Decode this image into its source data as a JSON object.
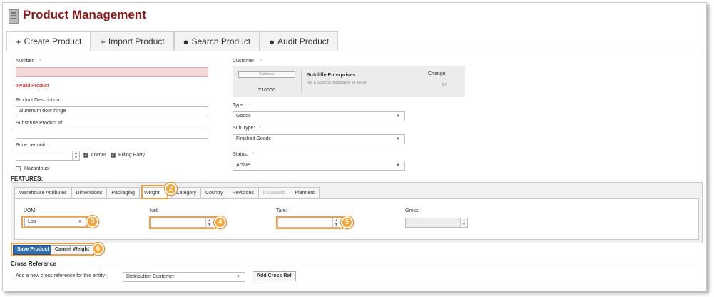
{
  "app": {
    "title": "Product Management"
  },
  "top_tabs": [
    {
      "icon": "+",
      "label": "Create Product"
    },
    {
      "icon": "+",
      "label": "Import Product"
    },
    {
      "icon": "●",
      "label": "Search Product"
    },
    {
      "icon": "●",
      "label": "Audit Product"
    }
  ],
  "form": {
    "number_label": "Number:",
    "required_mark": "*",
    "number_value": "",
    "number_error": "Invalid Product",
    "description_label": "Product Description:",
    "description_value": "aluminum door hinge",
    "substitute_label": "Substitute Product Id:",
    "substitute_value": "",
    "price_label": "Price per unit:",
    "price_value": "",
    "owner_label": "Owner",
    "owner_checked": true,
    "billing_label": "Billing Party",
    "billing_checked": true,
    "hazardous_label": "Hazardous",
    "hazardous_checked": false
  },
  "customer": {
    "label": "Customer:",
    "button_label": "Customer",
    "code": "T10000",
    "name": "Sutcliffe Enterprises",
    "address": "500 E South St, Kalamazoo MI 49048",
    "change_link": "Change",
    "tz": "ET"
  },
  "type_field": {
    "label": "Type:",
    "value": "Goods"
  },
  "subtype_field": {
    "label": "Sub Type:",
    "value": "Finished Goods"
  },
  "status_field": {
    "label": "Status:",
    "value": "Active"
  },
  "features": {
    "title": "FEATURES:",
    "tabs": [
      {
        "label": "Warehouse Attributes"
      },
      {
        "label": "Dimensions"
      },
      {
        "label": "Packaging"
      },
      {
        "label": "Weight"
      },
      {
        "label": "Category"
      },
      {
        "label": "Country"
      },
      {
        "label": "Revisions"
      },
      {
        "label": "Kit Details"
      },
      {
        "label": "Planners"
      }
    ],
    "weight": {
      "uom_label": "UOM:",
      "uom_value": "Lbs",
      "net_label": "Net:",
      "net_value": "",
      "tare_label": "Tare:",
      "tare_value": "",
      "gross_label": "Gross:",
      "gross_value": ""
    }
  },
  "actions": {
    "save_label": "Save Product",
    "cancel_label": "Cancel Weight"
  },
  "cross_ref": {
    "title": "Cross Reference",
    "add_label": "Add a new cross reference for this entity :",
    "select_value": "Distribution Customer",
    "button_label": "Add Cross Ref"
  },
  "callouts": [
    "2",
    "3",
    "4",
    "5",
    "6"
  ],
  "colors": {
    "title": "#8b1a1a",
    "primary": "#2f6fb1",
    "callout": "#f7a439",
    "error": "#cc0000"
  }
}
